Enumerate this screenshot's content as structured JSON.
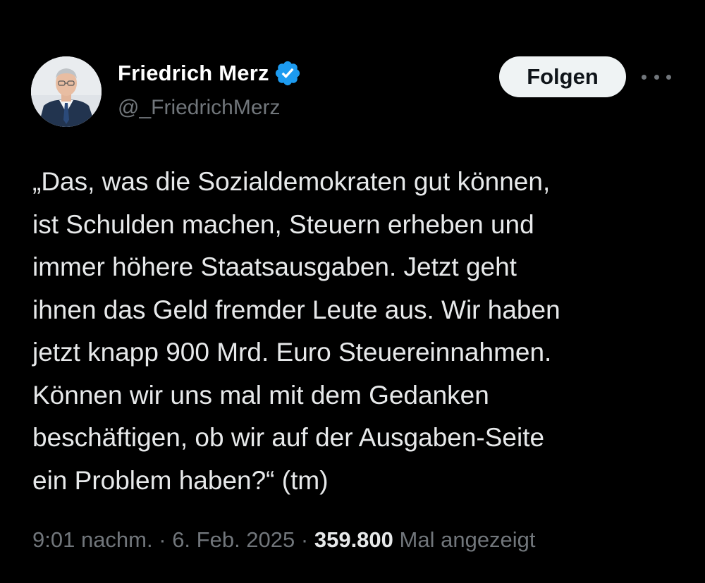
{
  "author": {
    "display_name": "Friedrich Merz",
    "handle": "@_FriedrichMerz",
    "verified": true,
    "avatar_icon": "person-portrait-avatar",
    "verified_icon": "verified-badge-icon"
  },
  "actions": {
    "follow_label": "Folgen",
    "more_icon": "more-horizontal-icon"
  },
  "tweet": {
    "lines": [
      "„Das, was die Sozialdemokraten gut können,",
      "ist Schulden machen, Steuern erheben und",
      "immer höhere Staatsausgaben. Jetzt geht",
      "ihnen das Geld fremder Leute aus. Wir haben",
      "jetzt knapp 900 Mrd. Euro Steuereinnahmen.",
      "Können wir uns mal mit dem Gedanken",
      "beschäftigen, ob wir auf der Ausgaben-Seite",
      "ein Problem haben?“ (tm)"
    ]
  },
  "meta": {
    "time": "9:01 nachm.",
    "separator": "·",
    "date": "6. Feb. 2025",
    "views_count": "359.800",
    "views_label": "Mal angezeigt"
  },
  "colors": {
    "background": "#000000",
    "text_primary": "#e7e9ea",
    "text_secondary": "#71767b",
    "verified_blue": "#1d9bf0",
    "follow_button_bg": "#eff3f4",
    "follow_button_text": "#0f1419"
  }
}
